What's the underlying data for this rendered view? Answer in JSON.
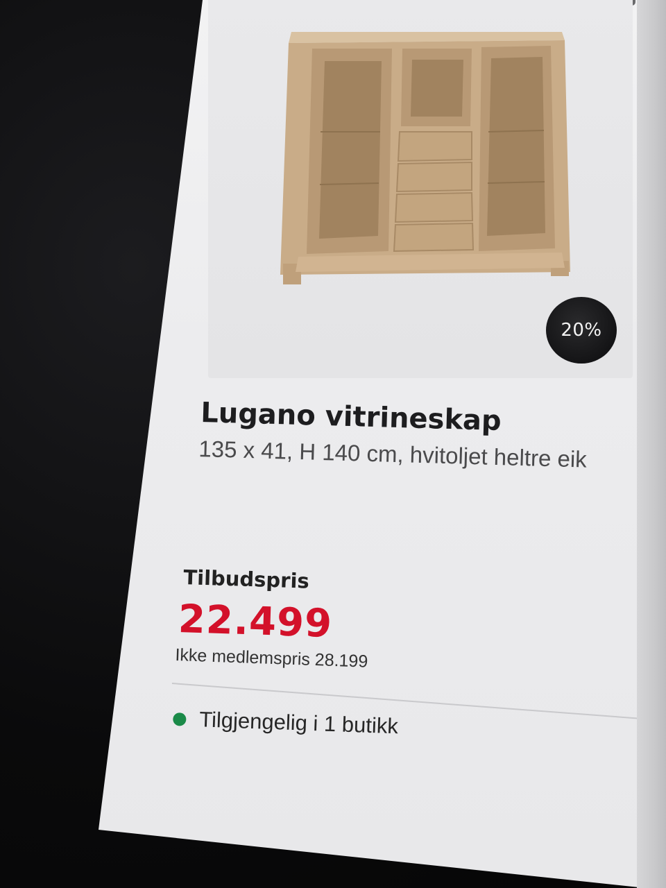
{
  "product": {
    "discount_badge": "20%",
    "title": "Lugano vitrineskap",
    "subtitle": "135 x 41, H 140 cm, hvitoljet heltre eik",
    "image_alt_icon": "cabinet-illustration",
    "wood_color": "#c9ac88"
  },
  "pricing": {
    "label": "Tilbudspris",
    "price": "22.499",
    "member_price_note": "Ikke medlemspris 28.199",
    "price_color": "#d3112a"
  },
  "stock": {
    "text": "Tilgjengelig i 1 butikk",
    "status_color": "#1a8a48"
  }
}
